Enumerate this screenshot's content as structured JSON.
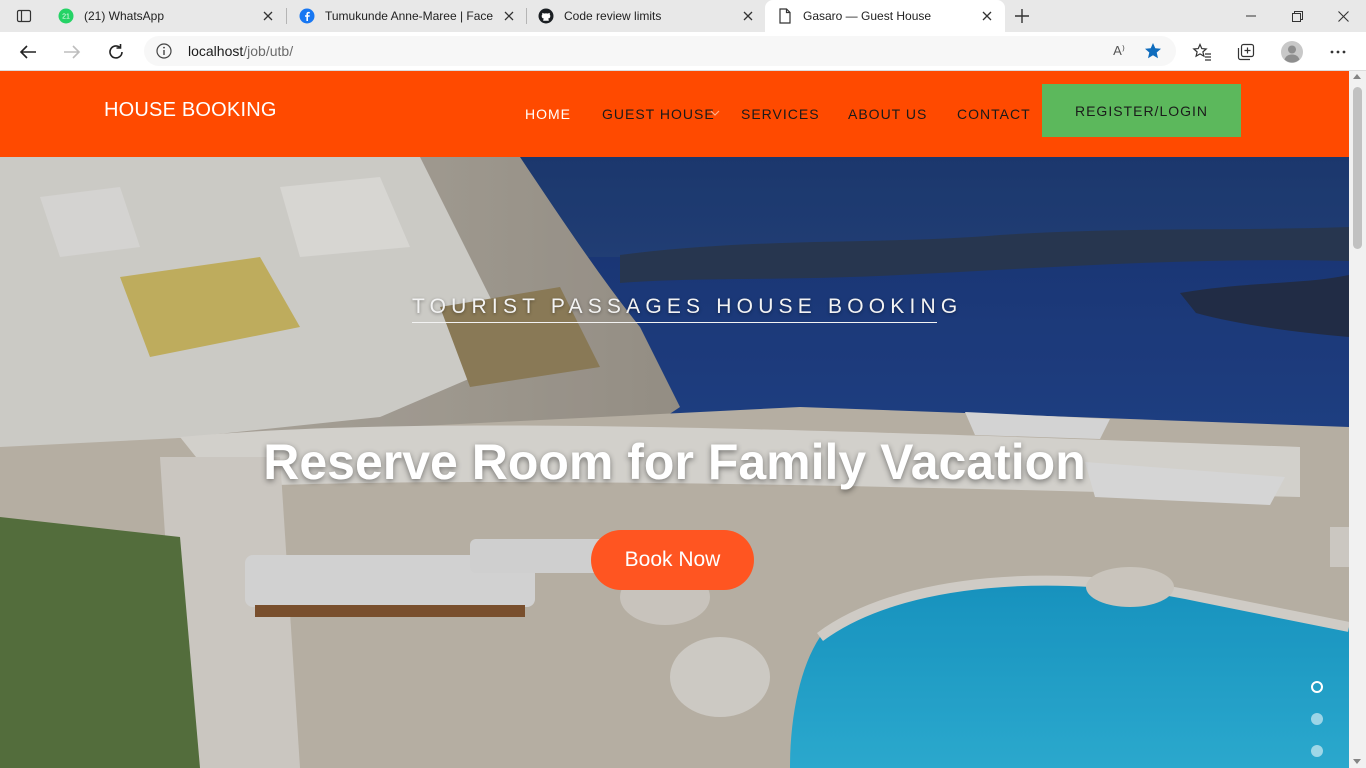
{
  "browser": {
    "tabs": [
      {
        "title": "(21) WhatsApp",
        "icon": "whatsapp-icon",
        "badge": "21"
      },
      {
        "title": "Tumukunde Anne-Maree | Faceb",
        "icon": "facebook-icon"
      },
      {
        "title": "Code review limits",
        "icon": "github-icon"
      },
      {
        "title": "Gasaro — Guest House",
        "icon": "page-icon",
        "active": true
      }
    ],
    "address": {
      "host": "localhost",
      "path": "/job/utb/"
    },
    "read_aloud_glyph": "A⁾",
    "colors": {
      "accent": "#0f6cbd"
    }
  },
  "site": {
    "brand": "HOUSE BOOKING",
    "nav": [
      {
        "label": "HOME",
        "active": true
      },
      {
        "label": "GUEST HOUSE",
        "has_dropdown": true
      },
      {
        "label": "SERVICES"
      },
      {
        "label": "ABOUT US"
      },
      {
        "label": "CONTACT"
      }
    ],
    "cta_label": "REGISTER/LOGIN",
    "colors": {
      "header": "#ff4a00",
      "cta": "#5cb85c",
      "book_button": "#ff5521"
    }
  },
  "hero": {
    "eyebrow": "TOURIST PASSAGES HOUSE BOOKING",
    "title": "Reserve Room for Family Vacation",
    "button_label": "Book Now",
    "slides": {
      "count": 3,
      "active_index": 0
    }
  }
}
